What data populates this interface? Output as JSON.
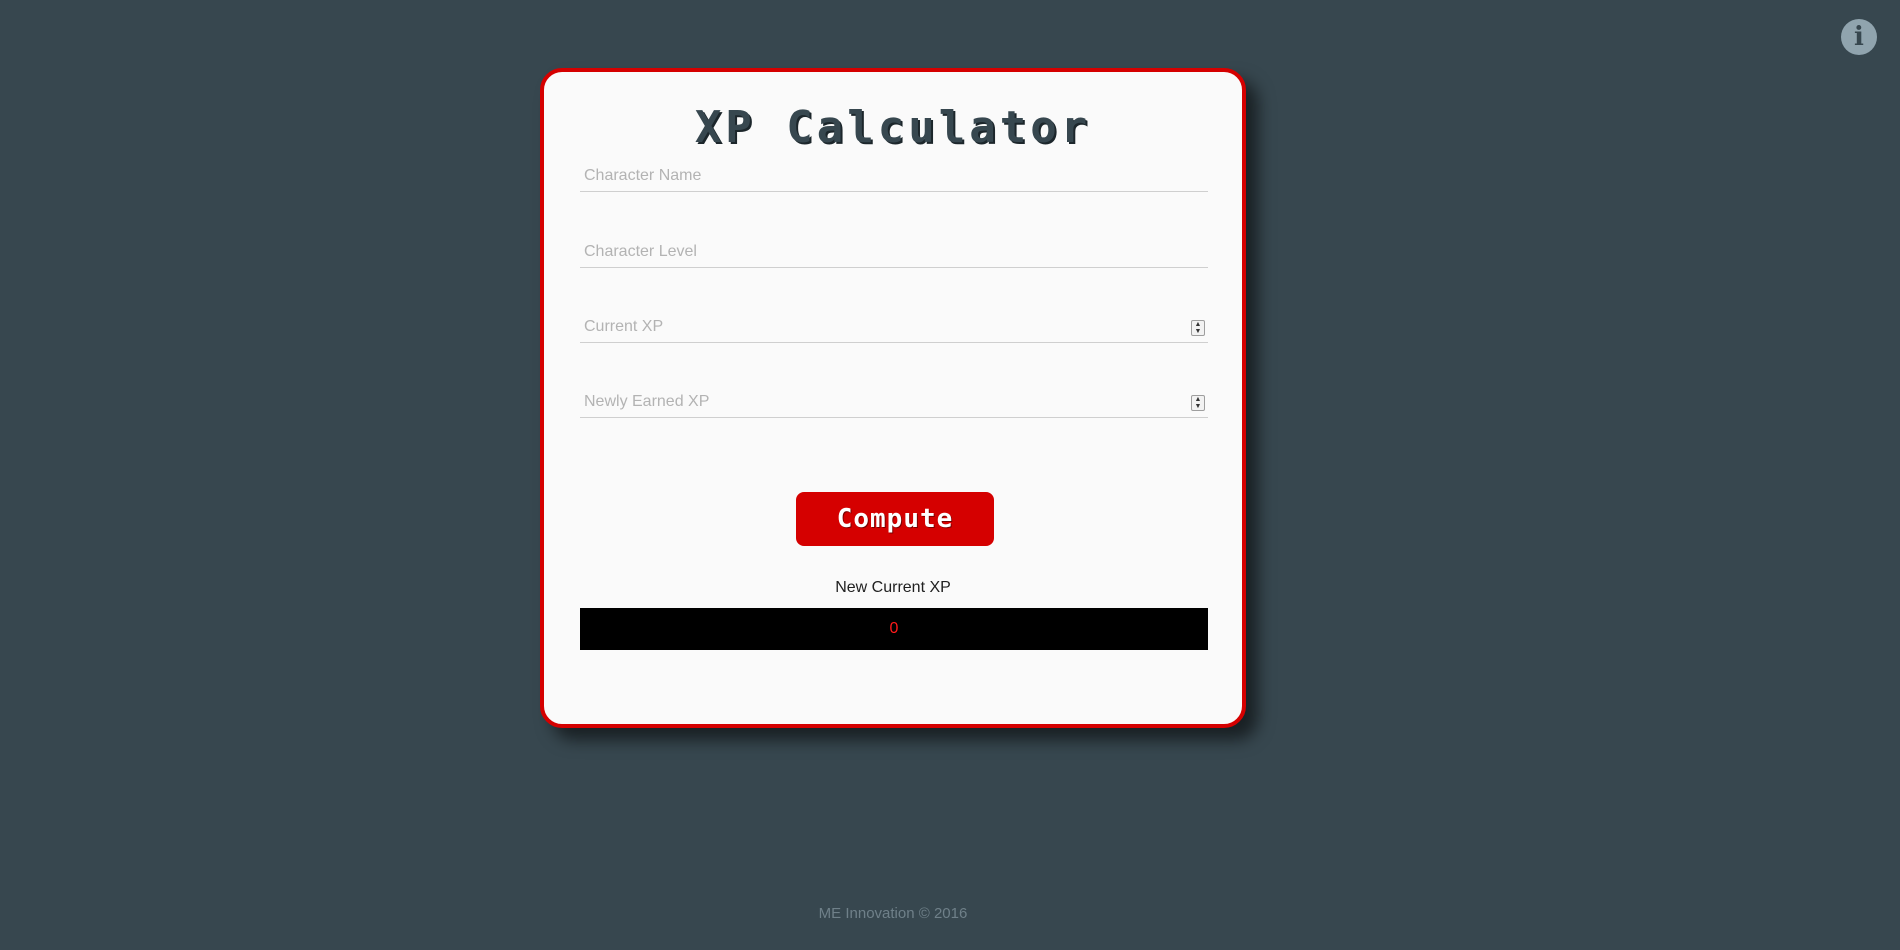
{
  "info": {
    "icon": "info-icon",
    "glyph": "i"
  },
  "card": {
    "title": "XP Calculator",
    "fields": {
      "character_name": {
        "placeholder": "Character Name",
        "value": ""
      },
      "character_level": {
        "placeholder": "Character Level",
        "value": ""
      },
      "current_xp": {
        "placeholder": "Current XP",
        "value": ""
      },
      "newly_earned_xp": {
        "placeholder": "Newly Earned XP",
        "value": ""
      }
    },
    "compute_label": "Compute",
    "result_label": "New Current XP",
    "result_value": "0"
  },
  "footer": {
    "text": "ME Innovation © 2016"
  },
  "colors": {
    "background": "#37474f",
    "accent": "#d50000",
    "card": "#fafafa",
    "result_text": "#ff1a1a"
  }
}
